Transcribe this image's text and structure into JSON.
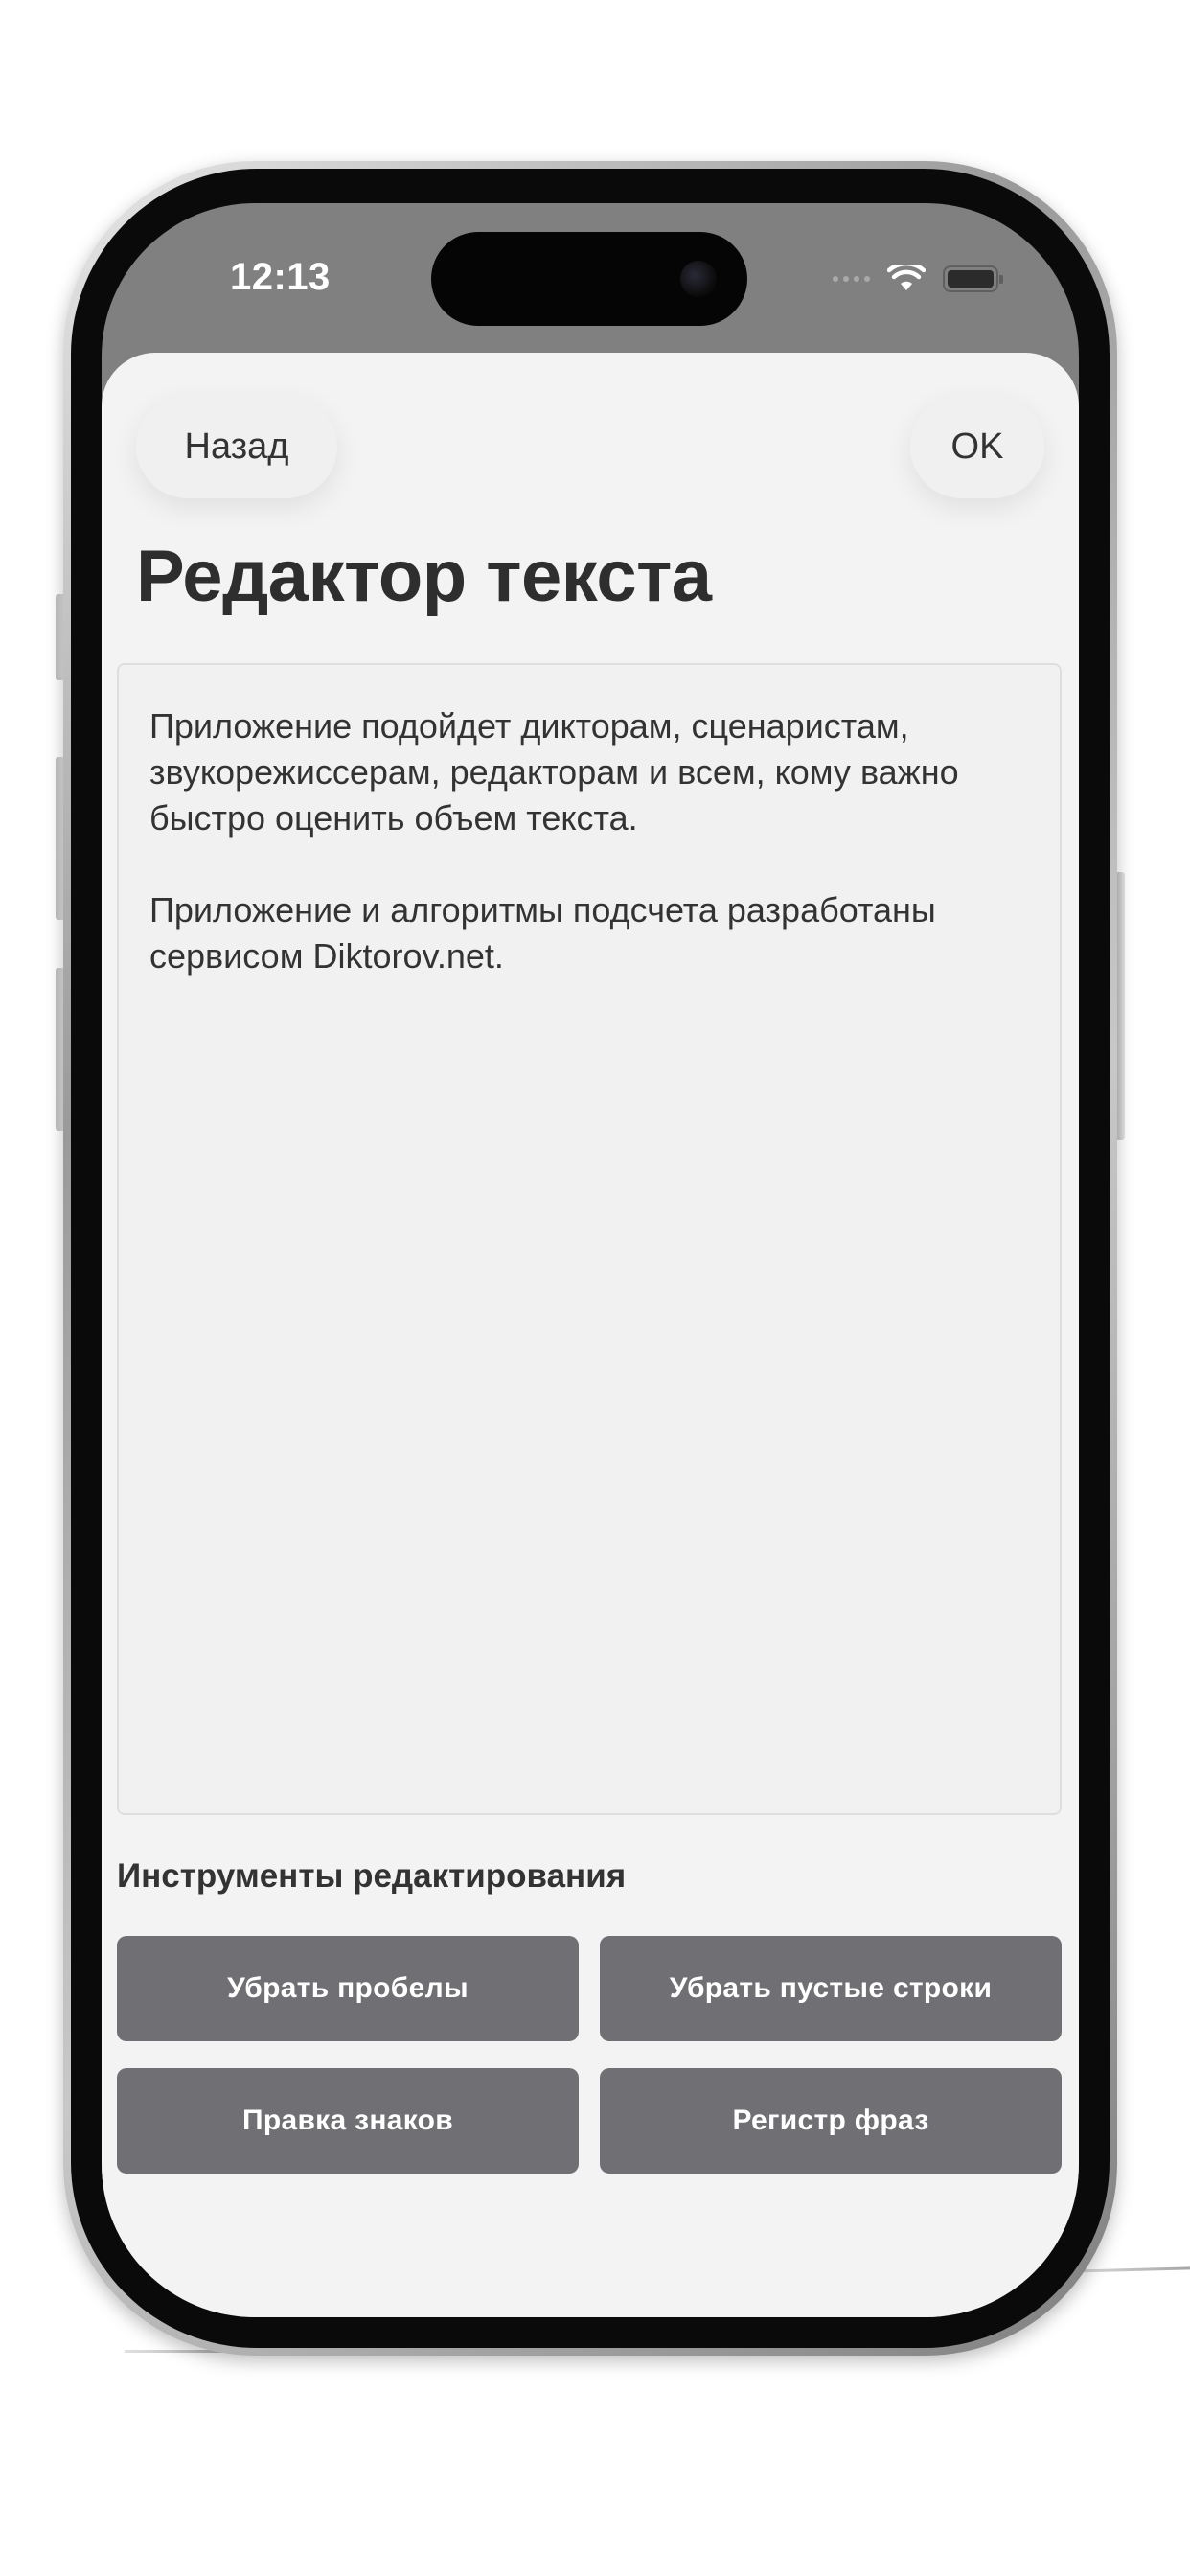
{
  "status_bar": {
    "time": "12:13"
  },
  "nav": {
    "back_label": "Назад",
    "ok_label": "OK"
  },
  "page": {
    "title": "Редактор текста"
  },
  "editor": {
    "paragraphs": [
      "Приложение подойдет дикторам, сценаристам, звукорежиссерам, редакторам и всем, кому важно быстро оценить объем текста.",
      "Приложение и алгоритмы подсчета разработаны сервисом Diktorov.net."
    ]
  },
  "tools": {
    "heading": "Инструменты редактирования",
    "buttons": [
      "Убрать пробелы",
      "Убрать пустые строки",
      "Правка знаков",
      "Регистр фраз"
    ]
  },
  "colors": {
    "sheet_background": "#f3f3f3",
    "tool_button": "#707074",
    "status_bar_background": "#808080"
  },
  "icons": [
    "wifi-icon",
    "battery-icon",
    "signal-icon"
  ]
}
